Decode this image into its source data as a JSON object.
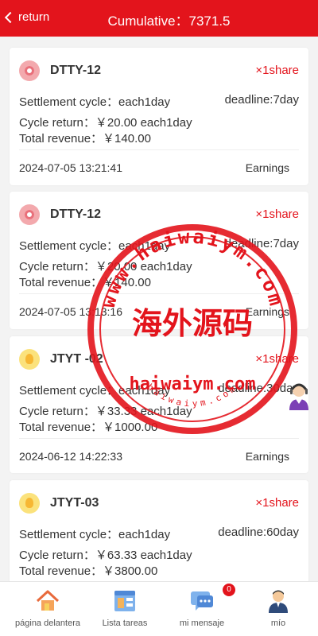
{
  "header": {
    "back_label": "return",
    "title": "Cumulative：7371.5"
  },
  "cards": [
    {
      "name": "DTTY-12",
      "share": "×1share",
      "cycle": "Settlement cycle：each1day",
      "deadline": "deadline:7day",
      "cycle_return": "Cycle return：￥20.00 each1day",
      "total_revenue": "Total revenue：￥140.00",
      "date": "2024-07-05 13:21:41",
      "status": "Earnings",
      "icon": "pink-gift-icon"
    },
    {
      "name": "DTTY-12",
      "share": "×1share",
      "cycle": "Settlement cycle：each1day",
      "deadline": "deadline:7day",
      "cycle_return": "Cycle return：￥20.00 each1day",
      "total_revenue": "Total revenue：￥140.00",
      "date": "2024-07-05 13:13:16",
      "status": "Earnings",
      "icon": "pink-gift-icon"
    },
    {
      "name": "JTYT -02",
      "share": "×1share",
      "cycle": "Settlement cycle：each1day",
      "deadline": "deadline:30day",
      "cycle_return": "Cycle return：￥33.33 each1day",
      "total_revenue": "Total revenue：￥1000.00",
      "date": "2024-06-12 14:22:33",
      "status": "Earnings",
      "icon": "lightbulb-icon"
    },
    {
      "name": "JTYT-03",
      "share": "×1share",
      "cycle": "Settlement cycle：each1day",
      "deadline": "deadline:60day",
      "cycle_return": "Cycle return：￥63.33 each1day",
      "total_revenue": "Total revenue：￥3800.00",
      "icon": "lightbulb-icon"
    }
  ],
  "stamp": {
    "top_text": "www.haiwaiym.com",
    "center_text": "海外源码",
    "bottom_text": "haiwaiym.com",
    "small_text": "haiwaiym.com",
    "color": "#e3141c"
  },
  "tabbar": {
    "items": [
      {
        "label": "página delantera",
        "icon": "home-icon"
      },
      {
        "label": "Lista tareas",
        "icon": "task-list-icon"
      },
      {
        "label": "mi mensaje",
        "icon": "message-icon",
        "badge": "0"
      },
      {
        "label": "mío",
        "icon": "profile-icon"
      }
    ]
  },
  "colors": {
    "accent": "#e3141c",
    "background": "#f3f3f3"
  }
}
